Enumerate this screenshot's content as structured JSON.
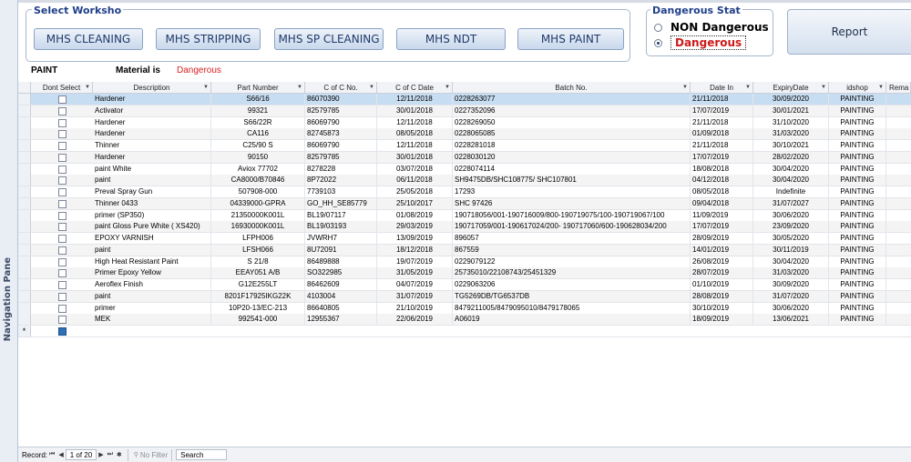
{
  "nav_pane": {
    "label": "Navigation Pane"
  },
  "workshop": {
    "legend": "Select Worksho",
    "buttons": [
      "MHS CLEANING",
      "MHS STRIPPING",
      "MHS SP CLEANING",
      "MHS NDT",
      "MHS PAINT"
    ]
  },
  "dangerous": {
    "legend": "Dangerous Stat",
    "options": [
      "NON Dangerous",
      "Dangerous"
    ],
    "selected": "Dangerous"
  },
  "report_label": "Report",
  "info": {
    "shop": "PAINT",
    "material_label": "Material is",
    "material_value": "Dangerous"
  },
  "grid": {
    "headers": [
      "Dont Select",
      "Description",
      "Part Number",
      "C of C No.",
      "C of C Date",
      "Batch No.",
      "Date In",
      "ExpiryDate",
      "idshop",
      "Rema"
    ],
    "rows": [
      [
        "",
        "Hardener",
        "S66/16",
        "86070390",
        "12/11/2018",
        "0228263077",
        "21/11/2018",
        "30/09/2020",
        "PAINTING"
      ],
      [
        "",
        "Activator",
        "99321",
        "82579785",
        "30/01/2018",
        "0227352096",
        "17/07/2019",
        "30/01/2021",
        "PAINTING"
      ],
      [
        "",
        "Hardener",
        "S66/22R",
        "86069790",
        "12/11/2018",
        "0228269050",
        "21/11/2018",
        "31/10/2020",
        "PAINTING"
      ],
      [
        "",
        "Hardener",
        "CA116",
        "82745873",
        "08/05/2018",
        "0228065085",
        "01/09/2018",
        "31/03/2020",
        "PAINTING"
      ],
      [
        "",
        "Thinner",
        "C25/90 S",
        "86069790",
        "12/11/2018",
        "0228281018",
        "21/11/2018",
        "30/10/2021",
        "PAINTING"
      ],
      [
        "",
        "Hardener",
        "90150",
        "82579785",
        "30/01/2018",
        "0228030120",
        "17/07/2019",
        "28/02/2020",
        "PAINTING"
      ],
      [
        "",
        "paint White",
        "Aviox 77702",
        "8278228",
        "03/07/2018",
        "0228074114",
        "18/08/2018",
        "30/04/2020",
        "PAINTING"
      ],
      [
        "",
        "paint",
        "CA8000/B70846",
        "8P72022",
        "06/11/2018",
        "SH9475DB/SHC108775/ SHC107801",
        "04/12/2018",
        "30/04/2020",
        "PAINTING"
      ],
      [
        "",
        "Preval Spray Gun",
        "507908-000",
        "7739103",
        "25/05/2018",
        "17293",
        "08/05/2018",
        "Indefinite",
        "PAINTING"
      ],
      [
        "",
        "Thinner 0433",
        "04339000-GPRA",
        "GO_HH_SE85779",
        "25/10/2017",
        "SHC 97426",
        "09/04/2018",
        "31/07/2027",
        "PAINTING"
      ],
      [
        "",
        "primer  (SP350)",
        "21350000K001L",
        "BL19/07117",
        "01/08/2019",
        "190718056/001-190716009/800-190719075/100-190719067/100",
        "11/09/2019",
        "30/06/2020",
        "PAINTING"
      ],
      [
        "",
        "paint Gloss Pure White  ( XS420)",
        "16930000K001L",
        "BL19/03193",
        "29/03/2019",
        "190717059/001-190617024/200- 190717060/600-190628034/200",
        "17/07/2019",
        "23/09/2020",
        "PAINTING"
      ],
      [
        "",
        "EPOXY VARNISH",
        "LFPH006",
        "JVWRH7",
        "13/09/2019",
        "896057",
        "28/09/2019",
        "30/05/2020",
        "PAINTING"
      ],
      [
        "",
        "paint",
        "LFSH066",
        "8U72091",
        "18/12/2018",
        "867559",
        "14/01/2019",
        "30/11/2019",
        "PAINTING"
      ],
      [
        "",
        "High Heat Resistant Paint",
        "S 21/8",
        "86489888",
        "19/07/2019",
        "0229079122",
        "26/08/2019",
        "30/04/2020",
        "PAINTING"
      ],
      [
        "",
        "Primer Epoxy Yellow",
        "EEAY051 A/B",
        "SO322985",
        "31/05/2019",
        "25735010/22108743/25451329",
        "28/07/2019",
        "31/03/2020",
        "PAINTING"
      ],
      [
        "",
        "Aeroflex Finish",
        "G12E255LT",
        "86462609",
        "04/07/2019",
        "0229063206",
        "01/10/2019",
        "30/09/2020",
        "PAINTING"
      ],
      [
        "",
        "paint",
        "8201F17925IKG22K",
        "4103004",
        "31/07/2019",
        "TG5269DB/TG6537DB",
        "28/08/2019",
        "31/07/2020",
        "PAINTING"
      ],
      [
        "",
        "primer",
        "10P20-13/EC-213",
        "86640805",
        "21/10/2019",
        "8479211005/8479095010/8479178065",
        "30/10/2019",
        "30/06/2020",
        "PAINTING"
      ],
      [
        "",
        "MEK",
        "992541-000",
        "12955367",
        "22/06/2019",
        "A06019",
        "18/09/2019",
        "13/06/2021",
        "PAINTING"
      ]
    ],
    "new_row_marker": "*"
  },
  "status": {
    "record_label": "Record:",
    "record_pos": "1 of 20",
    "filter_label": "No Filter",
    "search_label": "Search"
  }
}
